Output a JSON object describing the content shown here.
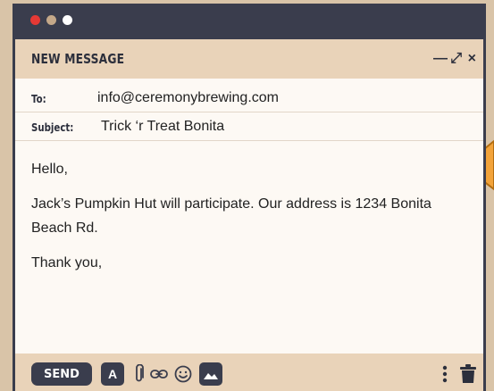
{
  "window": {
    "title": "NEW MESSAGE",
    "controls": {
      "minimize": "—",
      "expand": "⤢",
      "close": "×"
    }
  },
  "fields": {
    "to_label": "To:",
    "to_value": "info@ceremonybrewing.com",
    "subject_label": "Subject:",
    "subject_value": "Trick ‘r Treat Bonita"
  },
  "body": {
    "greeting": "Hello,",
    "paragraph": "Jack’s Pumpkin Hut will participate. Our address is 1234 Bonita Beach Rd.",
    "closing": "Thank you,"
  },
  "toolbar": {
    "send_label": "SEND",
    "format_label": "A",
    "icons": [
      "paperclip-icon",
      "link-icon",
      "emoji-icon",
      "image-icon",
      "more-vertical-icon",
      "trash-icon"
    ]
  },
  "colors": {
    "dark": "#3a3d4d",
    "header_bg": "#e9d3b9",
    "page_bg": "#d9c4a8",
    "paper": "#fdf9f4",
    "accent_arrow": "#f2a33a",
    "dot_red": "#e53935"
  }
}
